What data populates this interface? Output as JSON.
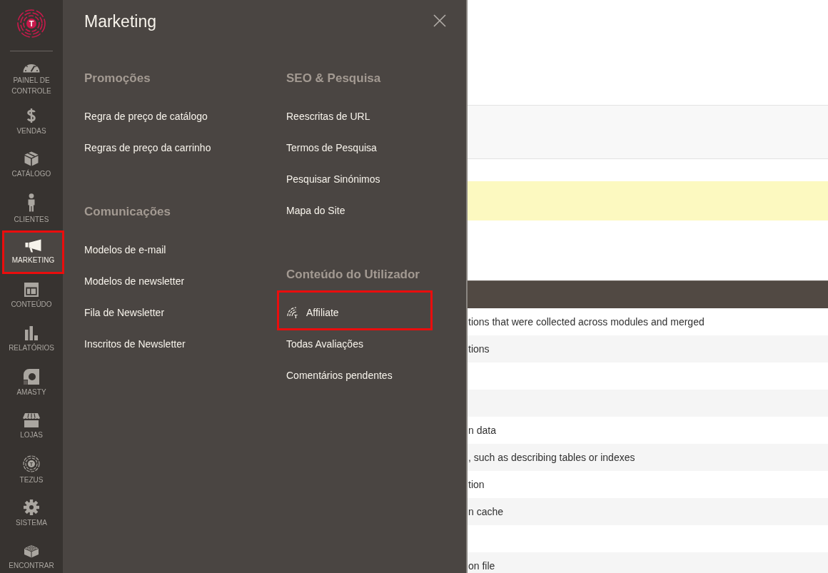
{
  "sidebar": {
    "logo": {
      "mark": "T"
    },
    "items": [
      {
        "label": "PAINEL DE CONTROLE",
        "selected": false,
        "highlighted": false
      },
      {
        "label": "VENDAS",
        "selected": false,
        "highlighted": false
      },
      {
        "label": "CATÁLOGO",
        "selected": false,
        "highlighted": false
      },
      {
        "label": "CLIENTES",
        "selected": false,
        "highlighted": false
      },
      {
        "label": "MARKETING",
        "selected": true,
        "highlighted": true
      },
      {
        "label": "CONTEÚDO",
        "selected": false,
        "highlighted": false
      },
      {
        "label": "RELATÓRIOS",
        "selected": false,
        "highlighted": false
      },
      {
        "label": "AMASTY",
        "selected": false,
        "highlighted": false
      },
      {
        "label": "LOJAS",
        "selected": false,
        "highlighted": false
      },
      {
        "label": "TEZUS",
        "icon_text": "T",
        "selected": false,
        "highlighted": false
      },
      {
        "label": "SISTEMA",
        "selected": false,
        "highlighted": false
      },
      {
        "label": "ENCONTRAR",
        "selected": false,
        "highlighted": false
      }
    ]
  },
  "menu": {
    "title": "Marketing",
    "columns": [
      {
        "sections": [
          {
            "heading": "Promoções",
            "items": [
              {
                "label": "Regra de preço de catálogo",
                "highlighted": false
              },
              {
                "label": "Regras de preço da carrinho",
                "highlighted": false
              }
            ]
          },
          {
            "heading": "Comunicações",
            "items": [
              {
                "label": "Modelos de e-mail",
                "highlighted": false
              },
              {
                "label": "Modelos de newsletter",
                "highlighted": false
              },
              {
                "label": "Fila de Newsletter",
                "highlighted": false
              },
              {
                "label": "Inscritos de Newsletter",
                "highlighted": false
              }
            ]
          }
        ]
      },
      {
        "sections": [
          {
            "heading": "SEO & Pesquisa",
            "items": [
              {
                "label": "Reescritas de URL",
                "highlighted": false
              },
              {
                "label": "Termos de Pesquisa",
                "highlighted": false
              },
              {
                "label": "Pesquisar Sinónimos",
                "highlighted": false
              },
              {
                "label": "Mapa do Site",
                "highlighted": false
              }
            ]
          },
          {
            "heading": "Conteúdo do Utilizador",
            "items": [
              {
                "label": "Affiliate",
                "icon_text": "T",
                "highlighted": true
              },
              {
                "label": "Todas Avaliações",
                "highlighted": false
              },
              {
                "label": "Comentários pendentes",
                "highlighted": false
              }
            ]
          }
        ]
      }
    ]
  },
  "page": {
    "table": {
      "rows": [
        {
          "text": "tions that were collected across modules and merged"
        },
        {
          "text": "tions"
        },
        {},
        {},
        {
          "text": "n data"
        },
        {
          "text": ", such as describing tables or indexes"
        },
        {
          "text": "tion"
        },
        {
          "text": "n cache"
        },
        {},
        {
          "text": "on file"
        }
      ]
    }
  }
}
